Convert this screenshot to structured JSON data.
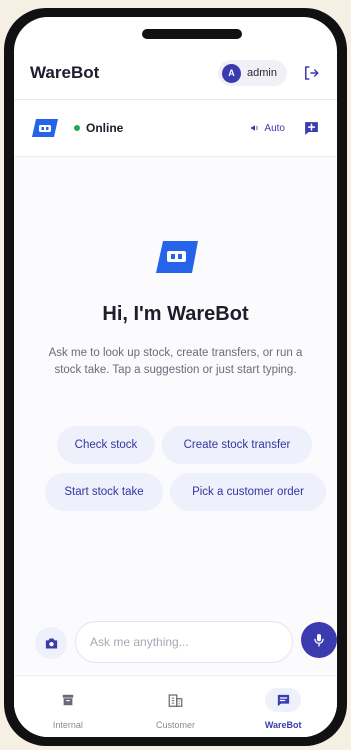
{
  "header": {
    "title": "WareBot",
    "user_initial": "A",
    "user_name": "admin"
  },
  "status": {
    "online_label": "Online",
    "auto_label": "Auto"
  },
  "hero": {
    "title": "Hi, I'm WareBot",
    "description": "Ask me to look up stock, create transfers, or run a stock take. Tap a suggestion or just start typing."
  },
  "suggestions": [
    "Check stock",
    "Create stock transfer",
    "Start stock take",
    "Pick a customer order"
  ],
  "composer": {
    "placeholder": "Ask me anything..."
  },
  "nav": {
    "items": [
      {
        "label": "Internal",
        "icon": "archive-icon",
        "active": false
      },
      {
        "label": "Customer",
        "icon": "building-icon",
        "active": false
      },
      {
        "label": "WareBot",
        "icon": "chat-icon",
        "active": true
      }
    ]
  },
  "colors": {
    "accent": "#3b3bb0",
    "logo": "#2563eb",
    "online": "#22a55a",
    "chip_bg": "#eef0fb"
  }
}
